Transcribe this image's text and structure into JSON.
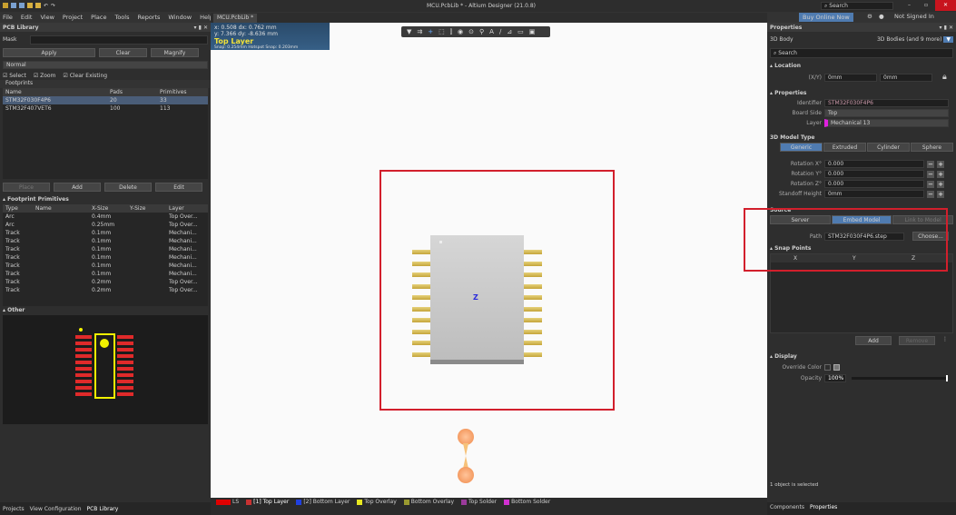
{
  "window": {
    "title": "MCU.PcbLib * - Altium Designer (21.0.8)",
    "search_placeholder": "Search",
    "buy": "Buy Online Now",
    "signed": "Not Signed In"
  },
  "menu": [
    "File",
    "Edit",
    "View",
    "Project",
    "Place",
    "Tools",
    "Reports",
    "Window",
    "Help"
  ],
  "left": {
    "title": "PCB Library",
    "mask_label": "Mask",
    "apply": "Apply",
    "clear": "Clear",
    "magnify": "Magnify",
    "mode": "Normal",
    "checks": [
      "Select",
      "Zoom",
      "Clear Existing"
    ],
    "footprints_label": "Footprints",
    "fp_headers": [
      "Name",
      "Pads",
      "Primitives"
    ],
    "footprints": [
      [
        "STM32F030F4P6",
        "20",
        "33"
      ],
      [
        "STM32F407VET6",
        "100",
        "113"
      ]
    ],
    "place": "Place",
    "add": "Add",
    "delete": "Delete",
    "edit": "Edit",
    "prim_title": "Footprint Primitives",
    "prim_headers": [
      "Type",
      "Name",
      "X-Size",
      "Y-Size",
      "Layer"
    ],
    "primitives": [
      [
        "Arc",
        "0.4mm",
        "Top Over..."
      ],
      [
        "Arc",
        "0.25mm",
        "Top Over..."
      ],
      [
        "Track",
        "0.1mm",
        "Mechani..."
      ],
      [
        "Track",
        "0.1mm",
        "Mechani..."
      ],
      [
        "Track",
        "0.1mm",
        "Mechani..."
      ],
      [
        "Track",
        "0.1mm",
        "Mechani..."
      ],
      [
        "Track",
        "0.1mm",
        "Mechani..."
      ],
      [
        "Track",
        "0.1mm",
        "Mechani..."
      ],
      [
        "Track",
        "0.2mm",
        "Top Over..."
      ],
      [
        "Track",
        "0.2mm",
        "Top Over..."
      ]
    ],
    "other_title": "Other",
    "bottom_tabs": [
      "Projects",
      "View Configuration",
      "PCB Library"
    ]
  },
  "doc": {
    "tab": "MCU.PcbLib *",
    "hud_line1": "x: 0.508   dx: 0.762 mm",
    "hud_line2": "y: 7.366   dy: -8.636 mm",
    "hud_layer": "Top Layer",
    "hud_snap": "Snap: 0.254mm Hotspot Snap: 0.203mm",
    "axis_label": "Z"
  },
  "layers": [
    {
      "name": "LS",
      "color": "#e00000"
    },
    {
      "name": "[1] Top Layer",
      "color": "#c83232"
    },
    {
      "name": "[2] Bottom Layer",
      "color": "#2040e0"
    },
    {
      "name": "Top Overlay",
      "color": "#e8e820"
    },
    {
      "name": "Bottom Overlay",
      "color": "#9a9a30"
    },
    {
      "name": "Top Solder",
      "color": "#9a3a9a"
    },
    {
      "name": "Bottom Solder",
      "color": "#d030d0"
    }
  ],
  "props": {
    "title": "Properties",
    "object": "3D Body",
    "filter": "3D Bodies (and 9 more)",
    "search": "Search",
    "location": "Location",
    "xy_label": "(X/Y)",
    "x": "0mm",
    "y": "0mm",
    "properties": "Properties",
    "identifier_label": "Identifier",
    "identifier": "STM32F030F4P6",
    "side_label": "Board Side",
    "side": "Top",
    "layer_label": "Layer",
    "layer": "Mechanical 13",
    "model_type": "3D Model Type",
    "model_tabs": [
      "Generic",
      "Extruded",
      "Cylinder",
      "Sphere"
    ],
    "rotations": [
      [
        "Rotation X°",
        "0.000"
      ],
      [
        "Rotation Y°",
        "0.000"
      ],
      [
        "Rotation Z°",
        "0.000"
      ],
      [
        "Standoff Height",
        "0mm"
      ]
    ],
    "source": "Source",
    "source_tabs": [
      "Server",
      "Embed Model",
      "Link to Model"
    ],
    "path_label": "Path",
    "path": "STM32F030F4P6.step",
    "choose": "Choose...",
    "snap": "Snap Points",
    "snap_headers": [
      "X",
      "Y",
      "Z"
    ],
    "add": "Add",
    "remove": "Remove",
    "display": "Display",
    "override": "Override Color",
    "opacity_label": "Opacity",
    "opacity": "100%",
    "opacity_value": 1.0,
    "status": "1 object is selected",
    "bottom_tabs": [
      "Components",
      "Properties"
    ]
  },
  "colors": {
    "accent": "#4f7bb0",
    "highlight": "#d21f2c"
  }
}
